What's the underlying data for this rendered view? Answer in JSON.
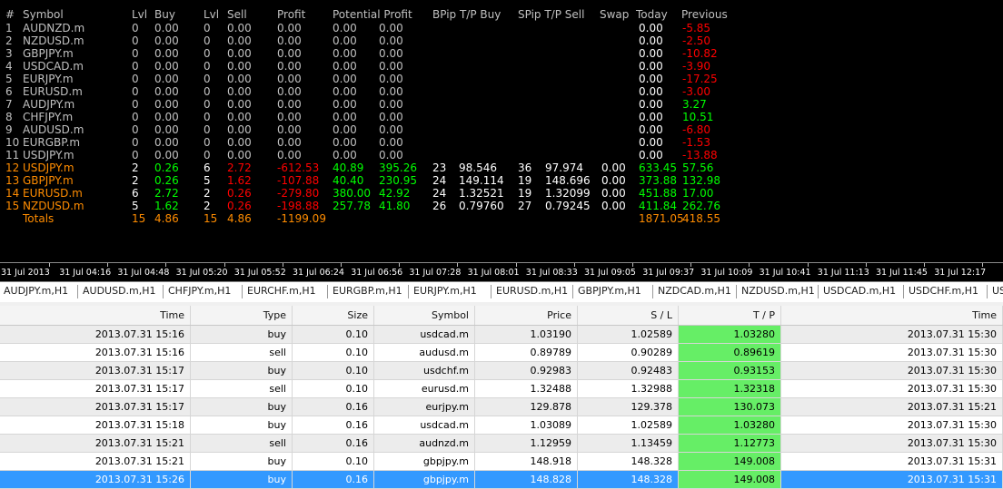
{
  "panel": {
    "headers": {
      "num": "#",
      "symbol": "Symbol",
      "lvl_buy": "Lvl",
      "buy": "Buy",
      "lvl_sell": "Lvl",
      "sell": "Sell",
      "profit": "Profit",
      "potential_profit": "Potential Profit",
      "bpip": "BPip T/P Buy",
      "spip": "SPip T/P Sell",
      "swap": "Swap",
      "today": "Today",
      "previous": "Previous"
    },
    "colors": {
      "header": "#c0c0c0",
      "inactive": "#c0c0c0",
      "active": "#ff8c00",
      "positive": "#00ff00",
      "negative": "#ff0000",
      "neutral": "#ffffff"
    },
    "rows": [
      {
        "num": "1",
        "symbol": "AUDNZD.m",
        "lvl_buy": "0",
        "buy": "0.00",
        "lvl_sell": "0",
        "sell": "0.00",
        "profit": "0.00",
        "pp_buy": "0.00",
        "pp_sell": "0.00",
        "bpip_n": "",
        "bpip_p": "",
        "spip_n": "",
        "spip_p": "",
        "swap": "",
        "today": "0.00",
        "previous": "-5.85",
        "active": false
      },
      {
        "num": "2",
        "symbol": "NZDUSD.m",
        "lvl_buy": "0",
        "buy": "0.00",
        "lvl_sell": "0",
        "sell": "0.00",
        "profit": "0.00",
        "pp_buy": "0.00",
        "pp_sell": "0.00",
        "bpip_n": "",
        "bpip_p": "",
        "spip_n": "",
        "spip_p": "",
        "swap": "",
        "today": "0.00",
        "previous": "-2.50",
        "active": false
      },
      {
        "num": "3",
        "symbol": "GBPJPY.m",
        "lvl_buy": "0",
        "buy": "0.00",
        "lvl_sell": "0",
        "sell": "0.00",
        "profit": "0.00",
        "pp_buy": "0.00",
        "pp_sell": "0.00",
        "bpip_n": "",
        "bpip_p": "",
        "spip_n": "",
        "spip_p": "",
        "swap": "",
        "today": "0.00",
        "previous": "-10.82",
        "active": false
      },
      {
        "num": "4",
        "symbol": "USDCAD.m",
        "lvl_buy": "0",
        "buy": "0.00",
        "lvl_sell": "0",
        "sell": "0.00",
        "profit": "0.00",
        "pp_buy": "0.00",
        "pp_sell": "0.00",
        "bpip_n": "",
        "bpip_p": "",
        "spip_n": "",
        "spip_p": "",
        "swap": "",
        "today": "0.00",
        "previous": "-3.90",
        "active": false
      },
      {
        "num": "5",
        "symbol": "EURJPY.m",
        "lvl_buy": "0",
        "buy": "0.00",
        "lvl_sell": "0",
        "sell": "0.00",
        "profit": "0.00",
        "pp_buy": "0.00",
        "pp_sell": "0.00",
        "bpip_n": "",
        "bpip_p": "",
        "spip_n": "",
        "spip_p": "",
        "swap": "",
        "today": "0.00",
        "previous": "-17.25",
        "active": false
      },
      {
        "num": "6",
        "symbol": "EURUSD.m",
        "lvl_buy": "0",
        "buy": "0.00",
        "lvl_sell": "0",
        "sell": "0.00",
        "profit": "0.00",
        "pp_buy": "0.00",
        "pp_sell": "0.00",
        "bpip_n": "",
        "bpip_p": "",
        "spip_n": "",
        "spip_p": "",
        "swap": "",
        "today": "0.00",
        "previous": "-3.00",
        "active": false
      },
      {
        "num": "7",
        "symbol": "AUDJPY.m",
        "lvl_buy": "0",
        "buy": "0.00",
        "lvl_sell": "0",
        "sell": "0.00",
        "profit": "0.00",
        "pp_buy": "0.00",
        "pp_sell": "0.00",
        "bpip_n": "",
        "bpip_p": "",
        "spip_n": "",
        "spip_p": "",
        "swap": "",
        "today": "0.00",
        "previous": "3.27",
        "active": false
      },
      {
        "num": "8",
        "symbol": "CHFJPY.m",
        "lvl_buy": "0",
        "buy": "0.00",
        "lvl_sell": "0",
        "sell": "0.00",
        "profit": "0.00",
        "pp_buy": "0.00",
        "pp_sell": "0.00",
        "bpip_n": "",
        "bpip_p": "",
        "spip_n": "",
        "spip_p": "",
        "swap": "",
        "today": "0.00",
        "previous": "10.51",
        "active": false
      },
      {
        "num": "9",
        "symbol": "AUDUSD.m",
        "lvl_buy": "0",
        "buy": "0.00",
        "lvl_sell": "0",
        "sell": "0.00",
        "profit": "0.00",
        "pp_buy": "0.00",
        "pp_sell": "0.00",
        "bpip_n": "",
        "bpip_p": "",
        "spip_n": "",
        "spip_p": "",
        "swap": "",
        "today": "0.00",
        "previous": "-6.80",
        "active": false
      },
      {
        "num": "10",
        "symbol": "EURGBP.m",
        "lvl_buy": "0",
        "buy": "0.00",
        "lvl_sell": "0",
        "sell": "0.00",
        "profit": "0.00",
        "pp_buy": "0.00",
        "pp_sell": "0.00",
        "bpip_n": "",
        "bpip_p": "",
        "spip_n": "",
        "spip_p": "",
        "swap": "",
        "today": "0.00",
        "previous": "-1.53",
        "active": false
      },
      {
        "num": "11",
        "symbol": "USDJPY.m",
        "lvl_buy": "0",
        "buy": "0.00",
        "lvl_sell": "0",
        "sell": "0.00",
        "profit": "0.00",
        "pp_buy": "0.00",
        "pp_sell": "0.00",
        "bpip_n": "",
        "bpip_p": "",
        "spip_n": "",
        "spip_p": "",
        "swap": "",
        "today": "0.00",
        "previous": "-13.88",
        "active": false
      },
      {
        "num": "12",
        "symbol": "USDJPY.m",
        "lvl_buy": "2",
        "buy": "0.26",
        "lvl_sell": "6",
        "sell": "2.72",
        "profit": "-612.53",
        "pp_buy": "40.89",
        "pp_sell": "395.26",
        "bpip_n": "23",
        "bpip_p": "98.546",
        "spip_n": "36",
        "spip_p": "97.974",
        "swap": "0.00",
        "today": "633.45",
        "previous": "57.56",
        "active": true
      },
      {
        "num": "13",
        "symbol": "GBPJPY.m",
        "lvl_buy": "2",
        "buy": "0.26",
        "lvl_sell": "5",
        "sell": "1.62",
        "profit": "-107.88",
        "pp_buy": "40.40",
        "pp_sell": "230.95",
        "bpip_n": "24",
        "bpip_p": "149.114",
        "spip_n": "19",
        "spip_p": "148.696",
        "swap": "0.00",
        "today": "373.88",
        "previous": "132.98",
        "active": true
      },
      {
        "num": "14",
        "symbol": "EURUSD.m",
        "lvl_buy": "6",
        "buy": "2.72",
        "lvl_sell": "2",
        "sell": "0.26",
        "profit": "-279.80",
        "pp_buy": "380.00",
        "pp_sell": "42.92",
        "bpip_n": "24",
        "bpip_p": "1.32521",
        "spip_n": "19",
        "spip_p": "1.32099",
        "swap": "0.00",
        "today": "451.88",
        "previous": "17.00",
        "active": true
      },
      {
        "num": "15",
        "symbol": "NZDUSD.m",
        "lvl_buy": "5",
        "buy": "1.62",
        "lvl_sell": "2",
        "sell": "0.26",
        "profit": "-198.88",
        "pp_buy": "257.78",
        "pp_sell": "41.80",
        "bpip_n": "26",
        "bpip_p": "0.79760",
        "spip_n": "27",
        "spip_p": "0.79245",
        "swap": "0.00",
        "today": "411.84",
        "previous": "262.76",
        "active": true
      }
    ],
    "totals": {
      "label": "Totals",
      "lvl_buy": "15",
      "buy": "4.86",
      "lvl_sell": "15",
      "sell": "4.86",
      "profit": "-1199.09",
      "today": "1871.05",
      "previous": "418.55"
    }
  },
  "timeline": [
    "31 Jul 2013",
    "31 Jul 04:16",
    "31 Jul 04:48",
    "31 Jul 05:20",
    "31 Jul 05:52",
    "31 Jul 06:24",
    "31 Jul 06:56",
    "31 Jul 07:28",
    "31 Jul 08:01",
    "31 Jul 08:33",
    "31 Jul 09:05",
    "31 Jul 09:37",
    "31 Jul 10:09",
    "31 Jul 10:41",
    "31 Jul 11:13",
    "31 Jul 11:45",
    "31 Jul 12:17"
  ],
  "tabs": [
    "AUDJPY.m,H1",
    "AUDUSD.m,H1",
    "CHFJPY.m,H1",
    "EURCHF.m,H1",
    "EURGBP.m,H1",
    "EURJPY.m,H1",
    "EURUSD.m,H1",
    "GBPJPY.m,H1",
    "NZDCAD.m,H1",
    "NZDUSD.m,H1",
    "USDCAD.m,H1",
    "USDCHF.m,H1",
    "US"
  ],
  "trades": {
    "columns": [
      "Time",
      "Type",
      "Size",
      "Symbol",
      "Price",
      "S / L",
      "T / P",
      "Time"
    ],
    "rows": [
      {
        "time": "2013.07.31 15:16",
        "type": "buy",
        "size": "0.10",
        "symbol": "usdcad.m",
        "price": "1.03190",
        "sl": "1.02589",
        "tp": "1.03280",
        "ctime": "2013.07.31 15:30"
      },
      {
        "time": "2013.07.31 15:16",
        "type": "sell",
        "size": "0.10",
        "symbol": "audusd.m",
        "price": "0.89789",
        "sl": "0.90289",
        "tp": "0.89619",
        "ctime": "2013.07.31 15:30"
      },
      {
        "time": "2013.07.31 15:17",
        "type": "buy",
        "size": "0.10",
        "symbol": "usdchf.m",
        "price": "0.92983",
        "sl": "0.92483",
        "tp": "0.93153",
        "ctime": "2013.07.31 15:30"
      },
      {
        "time": "2013.07.31 15:17",
        "type": "sell",
        "size": "0.10",
        "symbol": "eurusd.m",
        "price": "1.32488",
        "sl": "1.32988",
        "tp": "1.32318",
        "ctime": "2013.07.31 15:30"
      },
      {
        "time": "2013.07.31 15:17",
        "type": "buy",
        "size": "0.16",
        "symbol": "eurjpy.m",
        "price": "129.878",
        "sl": "129.378",
        "tp": "130.073",
        "ctime": "2013.07.31 15:21"
      },
      {
        "time": "2013.07.31 15:18",
        "type": "buy",
        "size": "0.16",
        "symbol": "usdcad.m",
        "price": "1.03089",
        "sl": "1.02589",
        "tp": "1.03280",
        "ctime": "2013.07.31 15:30"
      },
      {
        "time": "2013.07.31 15:21",
        "type": "sell",
        "size": "0.16",
        "symbol": "audnzd.m",
        "price": "1.12959",
        "sl": "1.13459",
        "tp": "1.12773",
        "ctime": "2013.07.31 15:30"
      },
      {
        "time": "2013.07.31 15:21",
        "type": "buy",
        "size": "0.10",
        "symbol": "gbpjpy.m",
        "price": "148.918",
        "sl": "148.328",
        "tp": "149.008",
        "ctime": "2013.07.31 15:31"
      },
      {
        "time": "2013.07.31 15:26",
        "type": "buy",
        "size": "0.16",
        "symbol": "gbpjpy.m",
        "price": "148.828",
        "sl": "148.328",
        "tp": "149.008",
        "ctime": "2013.07.31 15:31",
        "selected": true
      }
    ]
  }
}
